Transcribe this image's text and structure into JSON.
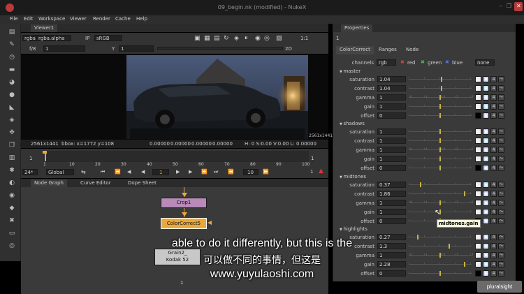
{
  "window": {
    "title": "09_begin.nk (modified) - NukeX",
    "min_glyph": "–",
    "max_glyph": "❐",
    "close_glyph": "✕"
  },
  "menu": [
    "File",
    "Edit",
    "Workspace",
    "Viewer",
    "Render",
    "Cache",
    "Help"
  ],
  "toolbar": [
    {
      "name": "read-tool-icon",
      "glyph": "▤"
    },
    {
      "name": "paint-brush-icon",
      "glyph": "✎"
    },
    {
      "name": "time-icon",
      "glyph": "◷"
    },
    {
      "name": "channel-icon",
      "glyph": "▬"
    },
    {
      "name": "color-icon",
      "glyph": "◕"
    },
    {
      "name": "filter-icon",
      "glyph": "●"
    },
    {
      "name": "keyer-icon",
      "glyph": "◣"
    },
    {
      "name": "merge-icon",
      "glyph": "◈"
    },
    {
      "name": "transform-icon",
      "glyph": "✥"
    },
    {
      "name": "3d-icon",
      "glyph": "❐"
    },
    {
      "name": "views-icon",
      "glyph": "▥"
    },
    {
      "name": "particles-icon",
      "glyph": "✱"
    },
    {
      "name": "deep-icon",
      "glyph": "◐"
    },
    {
      "name": "eye-icon",
      "glyph": "◉"
    },
    {
      "name": "tag-icon",
      "glyph": "◆"
    },
    {
      "name": "tools-icon",
      "glyph": "✖"
    },
    {
      "name": "other-icon",
      "glyph": "▭"
    },
    {
      "name": "plugins-icon",
      "glyph": "◎"
    }
  ],
  "viewer": {
    "tab_label": "Viewer1",
    "channels": "rgba",
    "alpha": "rgba.alpha",
    "ip": "IP",
    "colorspace": "sRGB",
    "fstop": "f/8",
    "gain": "1",
    "y_label": "Y",
    "gamma": "1",
    "ratio": "1:1",
    "mode": "2D",
    "resolution": "2561x1441",
    "info_resolution": "2561x1441",
    "bbox": "bbox: x=1772 y=108",
    "pixel_r": "0.00000",
    "pixel_g": "0.00000",
    "pixel_b": "0.00000",
    "pixel_a": "0.00000",
    "hsv": "H:  0 S:0.00 V:0.00  L: 0.00000"
  },
  "timeline": {
    "start": "1",
    "end": "1",
    "ticks": [
      "1",
      "10",
      "20",
      "30",
      "40",
      "50",
      "60",
      "70",
      "80",
      "90",
      "100"
    ],
    "fps": "24*",
    "range": "Global",
    "frame": "1",
    "step": "10",
    "labels_right": "1"
  },
  "nodegraph": {
    "tabs": [
      "Node Graph",
      "Curve Editor",
      "Dope Sheet"
    ],
    "nodes": {
      "crop": "Crop1",
      "cc": "ColorCorrect5",
      "grain_1": "Grain2_",
      "grain_2": "Kodak 52",
      "num": "1"
    }
  },
  "properties": {
    "tab_label": "Properties",
    "count": "1",
    "subtabs": [
      "ColorCorrect",
      "Ranges",
      "Node"
    ],
    "channels_label": "channels",
    "channels_value": "rgb",
    "chk_red": "red",
    "chk_green": "green",
    "chk_blue": "blue",
    "none": "none",
    "groups": {
      "master": "master",
      "shadows": "shadows",
      "midtones": "midtones",
      "highlights": "highlights"
    },
    "params": [
      "saturation",
      "contrast",
      "gamma",
      "gain",
      "offset"
    ],
    "values": {
      "master": [
        "1.04",
        "1.04",
        "1",
        "1",
        "0"
      ],
      "shadows": [
        "1",
        "1",
        "1",
        "1",
        "0"
      ],
      "midtones": [
        "0.37",
        "1.86",
        "1",
        "1",
        "0"
      ],
      "highlights": [
        "0.27",
        "1.3",
        "1",
        "2.28",
        "0"
      ]
    },
    "knob_pct": {
      "master": [
        0.52,
        0.52,
        0.5,
        0.5,
        0.5
      ],
      "shadows": [
        0.5,
        0.5,
        0.5,
        0.5,
        0.5
      ],
      "midtones": [
        0.18,
        0.9,
        0.5,
        0.5,
        0.5
      ],
      "highlights": [
        0.14,
        0.65,
        0.5,
        0.9,
        0.5
      ]
    },
    "tick_nums": [
      "0",
      "1",
      "0.4",
      "1",
      "2"
    ],
    "num_glyph": "4",
    "anim_glyph": "〜",
    "tooltip": "midtones.gain"
  },
  "subtitles": {
    "en": "able to do it differently, but this is the",
    "zh": "可以做不同的事情，但这是",
    "url": "www.yuyulaoshi.com"
  },
  "watermark": "pluralsight",
  "colors": {
    "crop_node": "#b88ab8",
    "cc_node": "#e8a83c",
    "grain_node": "#c8c8c8",
    "red": "#e04040",
    "green": "#40c040",
    "blue": "#5a70e0",
    "accent": "#e8a83c"
  }
}
